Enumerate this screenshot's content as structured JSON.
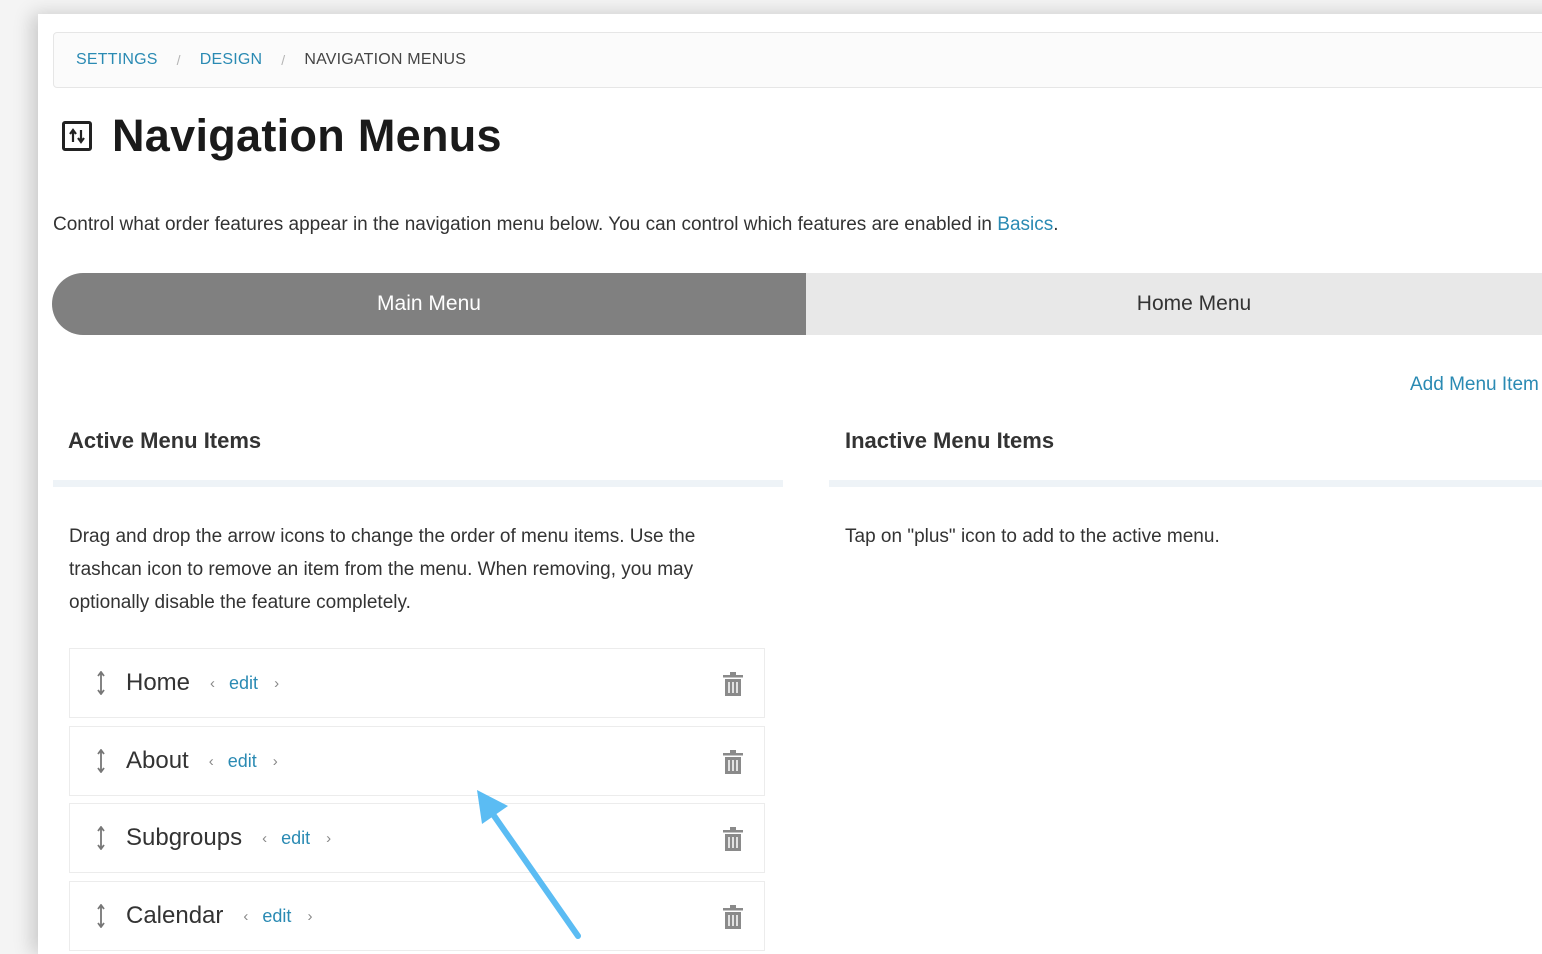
{
  "breadcrumb": {
    "items": [
      "SETTINGS",
      "DESIGN"
    ],
    "separator": "/",
    "current": "NAVIGATION MENUS"
  },
  "page": {
    "title": "Navigation Menus",
    "title_icon": "sort-arrows-box-icon",
    "description": "Control what order features appear in the navigation menu below. You can control which features are enabled in ",
    "description_link": "Basics",
    "description_end": "."
  },
  "tabs": [
    {
      "label": "Main Menu",
      "active": true
    },
    {
      "label": "Home Menu",
      "active": false
    }
  ],
  "add_menu_item_label": "Add Menu Item",
  "active_section": {
    "title": "Active Menu Items",
    "description": "Drag and drop the arrow icons to change the order of menu items. Use the trashcan icon to remove an item from the menu. When removing, you may optionally disable the feature completely.",
    "items": [
      {
        "label": "Home",
        "edit": "edit"
      },
      {
        "label": "About",
        "edit": "edit"
      },
      {
        "label": "Subgroups",
        "edit": "edit"
      },
      {
        "label": "Calendar",
        "edit": "edit"
      }
    ]
  },
  "inactive_section": {
    "title": "Inactive Menu Items",
    "description": "Tap on \"plus\" icon to add to the active menu."
  },
  "colors": {
    "link": "#2a8ab3",
    "tab_active": "#808080",
    "tab_inactive": "#e8e8e8",
    "annotation_arrow": "#5bbcf3"
  }
}
